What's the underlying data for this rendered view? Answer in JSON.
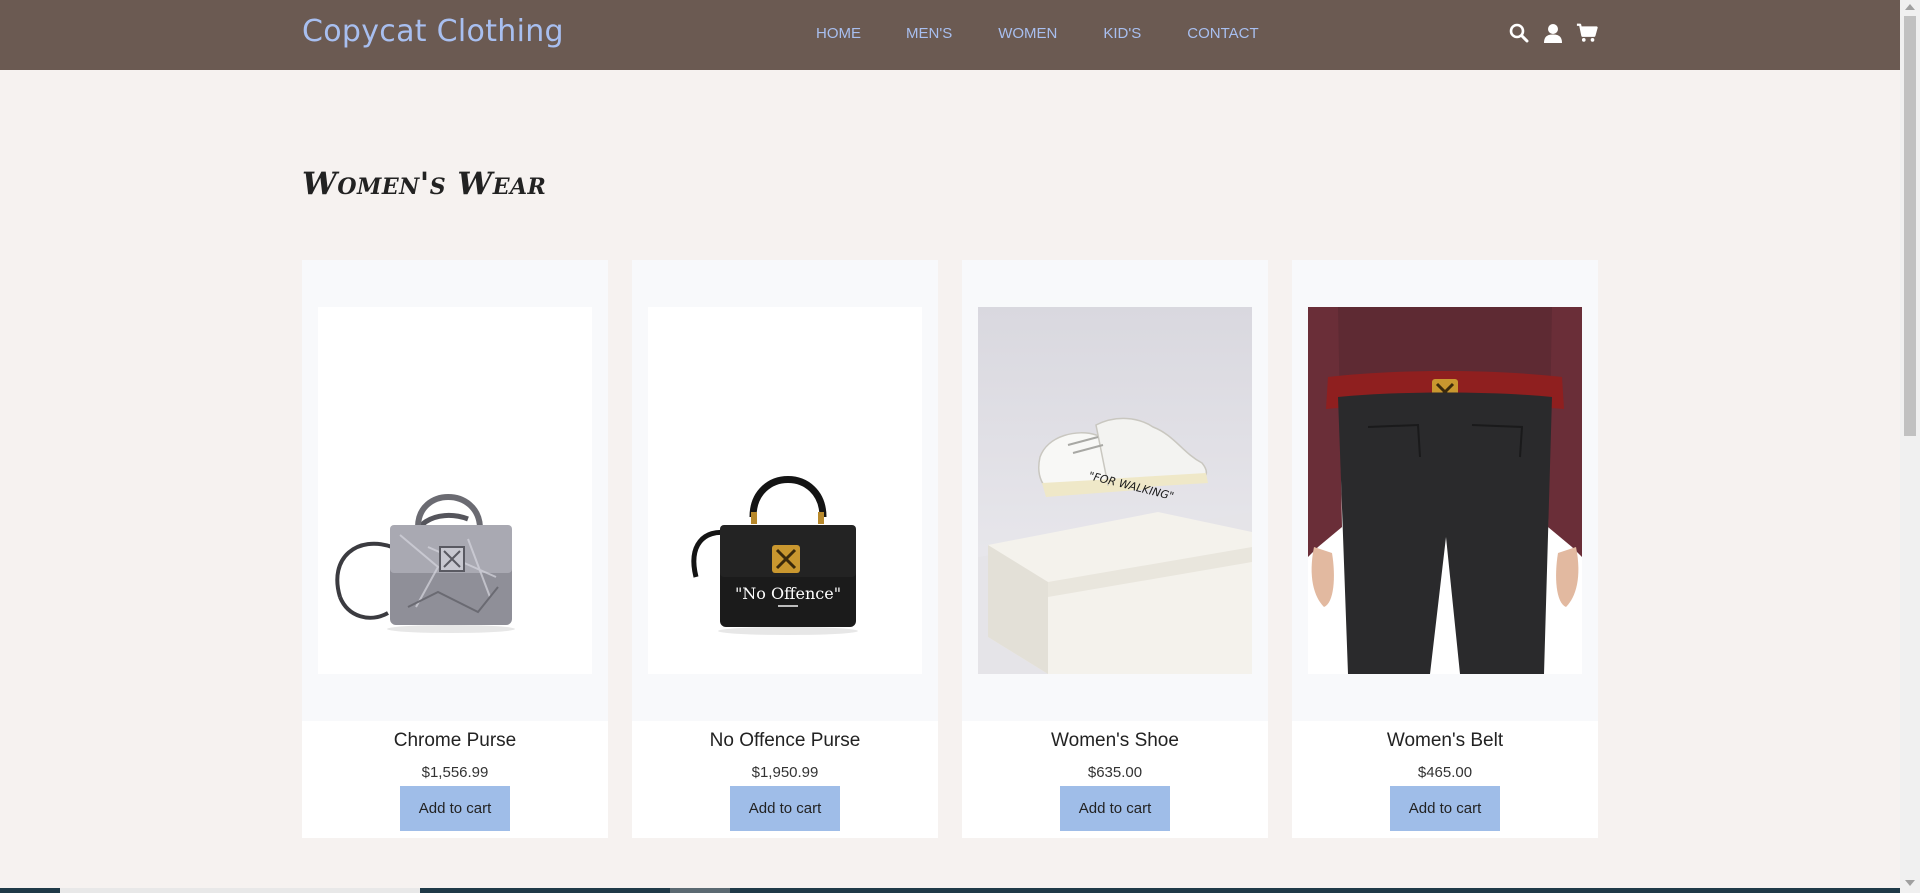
{
  "brand": {
    "name": "Copycat Clothing"
  },
  "nav": {
    "links": [
      "HOME",
      "MEN'S",
      "WOMEN",
      "KID'S",
      "CONTACT"
    ],
    "icons": [
      "search-icon",
      "user-icon",
      "cart-icon"
    ]
  },
  "page": {
    "heading": "Women's Wear"
  },
  "products": [
    {
      "name": "Chrome Purse",
      "price": "$1,556.99",
      "button": "Add to cart"
    },
    {
      "name": "No Offence Purse",
      "price": "$1,950.99",
      "button": "Add to cart"
    },
    {
      "name": "Women's Shoe",
      "price": "$635.00",
      "button": "Add to cart"
    },
    {
      "name": "Women's Belt",
      "price": "$465.00",
      "button": "Add to cart"
    }
  ],
  "images": {
    "bag_print": "\"No Offence\"",
    "shoe_print": "\"FOR WALKING\""
  },
  "colors": {
    "navbar": "#6b5a52",
    "brand": "#a8bff0",
    "page_bg": "#f6f2f0",
    "button_bg": "#9fbde8"
  }
}
